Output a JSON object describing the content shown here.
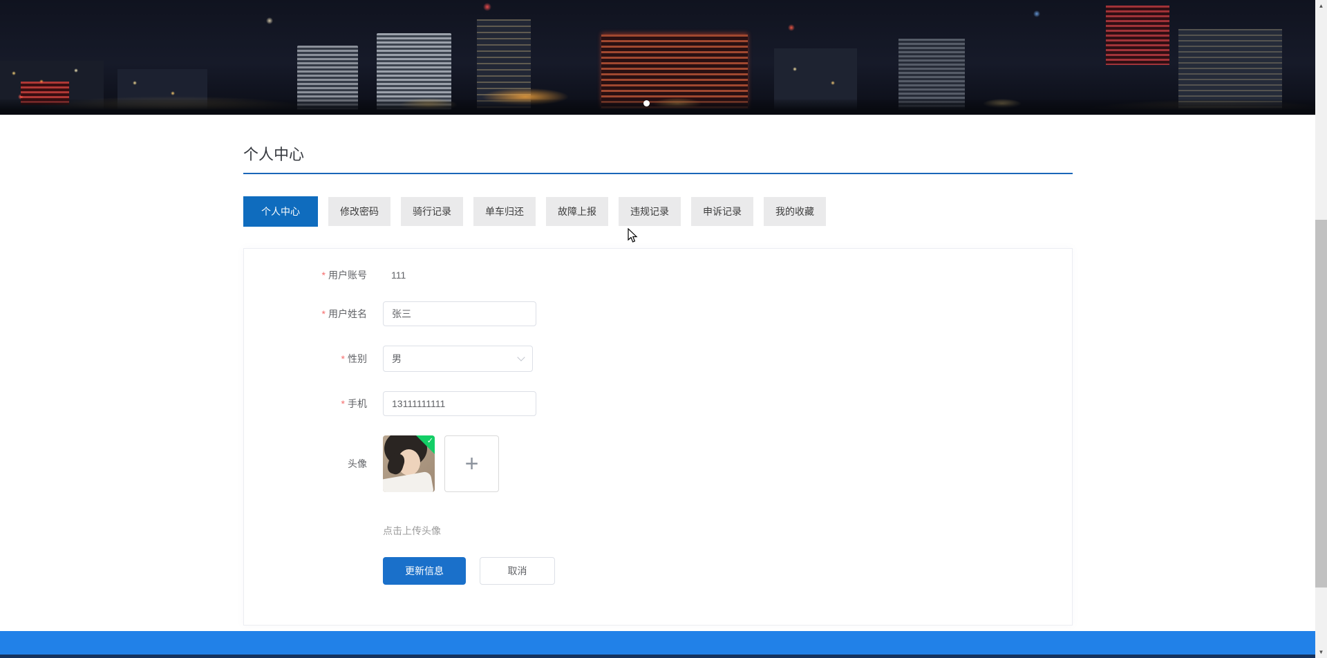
{
  "page": {
    "title": "个人中心"
  },
  "carousel": {
    "dot_count": 1
  },
  "tabs": [
    {
      "label": "个人中心",
      "active": true
    },
    {
      "label": "修改密码",
      "active": false
    },
    {
      "label": "骑行记录",
      "active": false
    },
    {
      "label": "单车归还",
      "active": false
    },
    {
      "label": "故障上报",
      "active": false
    },
    {
      "label": "违规记录",
      "active": false
    },
    {
      "label": "申诉记录",
      "active": false
    },
    {
      "label": "我的收藏",
      "active": false
    }
  ],
  "form": {
    "required_marker": "*",
    "account": {
      "label": "用户账号",
      "value": "111",
      "required": true
    },
    "name": {
      "label": "用户姓名",
      "value": "张三",
      "required": true
    },
    "gender": {
      "label": "性别",
      "value": "男",
      "required": true
    },
    "phone": {
      "label": "手机",
      "value": "13111111111",
      "required": true
    },
    "avatar": {
      "label": "头像",
      "required": false
    },
    "upload_hint": "点击上传头像",
    "update_button": "更新信息",
    "cancel_button": "取消"
  },
  "icons": {
    "check": "✓",
    "plus": "+",
    "scroll_up": "▲",
    "scroll_down": "▼"
  },
  "colors": {
    "primary_tab": "#0f6cbe",
    "primary_button": "#1a70ca",
    "title_underline": "#1a66b8",
    "footer_bar": "#2181e8",
    "footer_edge": "#15325d",
    "success_badge": "#13ce66",
    "required_mark": "#f56c6c"
  }
}
